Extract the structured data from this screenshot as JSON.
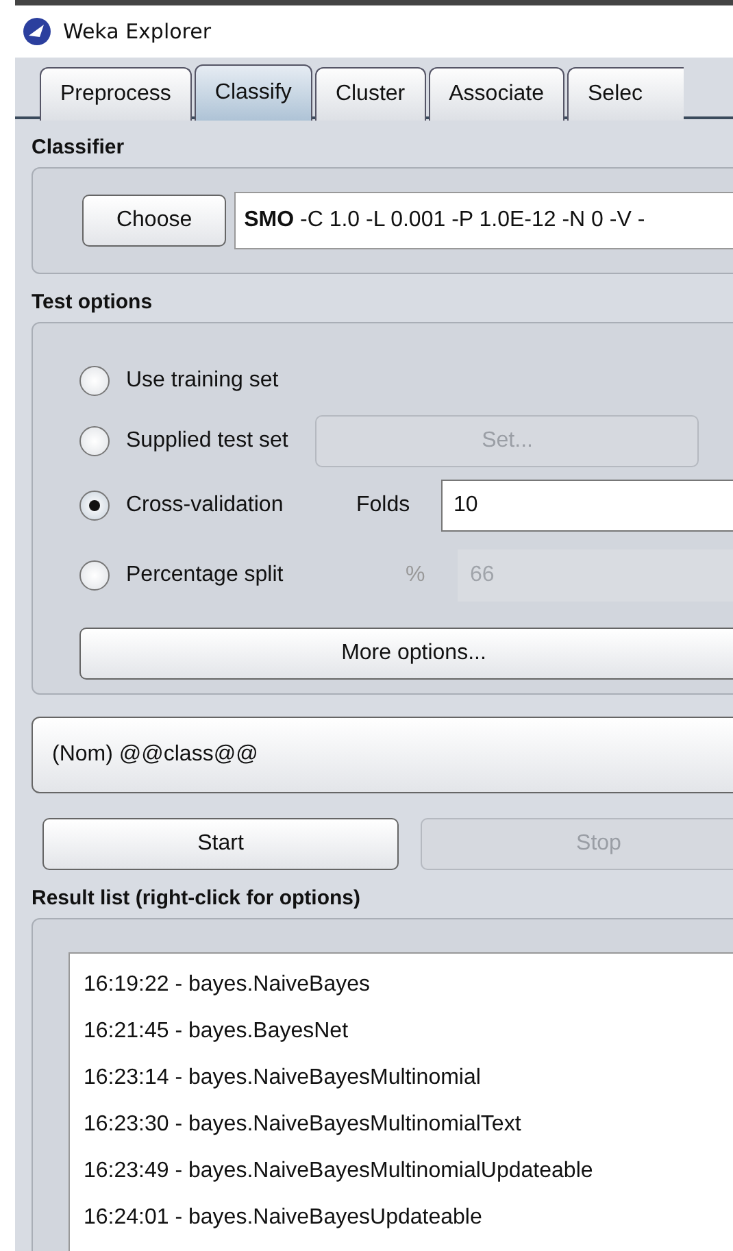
{
  "window": {
    "title": "Weka Explorer"
  },
  "tabs": [
    {
      "label": "Preprocess",
      "selected": false
    },
    {
      "label": "Classify",
      "selected": true
    },
    {
      "label": "Cluster",
      "selected": false
    },
    {
      "label": "Associate",
      "selected": false
    },
    {
      "label": "Selec",
      "selected": false
    }
  ],
  "classifier": {
    "heading": "Classifier",
    "choose_button": "Choose",
    "command": "**SMO** -C 1.0 -L 0.001 -P 1.0E-12 -N 0 -V -"
  },
  "test_options": {
    "heading": "Test options",
    "options": [
      {
        "label": "Use training set",
        "selected": false
      },
      {
        "label": "Supplied test set",
        "selected": false,
        "extra": {
          "kind": "button",
          "label": "Set...",
          "disabled": true
        }
      },
      {
        "label": "Cross-validation",
        "selected": true,
        "extra": {
          "kind": "field",
          "label": "Folds",
          "value": "10",
          "disabled": false
        }
      },
      {
        "label": "Percentage split",
        "selected": false,
        "extra": {
          "kind": "field",
          "label": "%",
          "value": "66",
          "disabled": true
        }
      }
    ],
    "more_button": "More options..."
  },
  "class_selector": {
    "value": "(Nom) @@class@@"
  },
  "buttons": [
    {
      "label": "Start",
      "disabled": false
    },
    {
      "label": "Stop",
      "disabled": true
    }
  ],
  "result_list": {
    "heading": "Result list (right-click for options)",
    "items": [
      "16:19:22 - bayes.NaiveBayes",
      "16:21:45 - bayes.BayesNet",
      "16:23:14 - bayes.NaiveBayesMultinomial",
      "16:23:30 - bayes.NaiveBayesMultinomialText",
      "16:23:49 - bayes.NaiveBayesMultinomialUpdateable",
      "16:24:01 - bayes.NaiveBayesUpdateable"
    ]
  }
}
